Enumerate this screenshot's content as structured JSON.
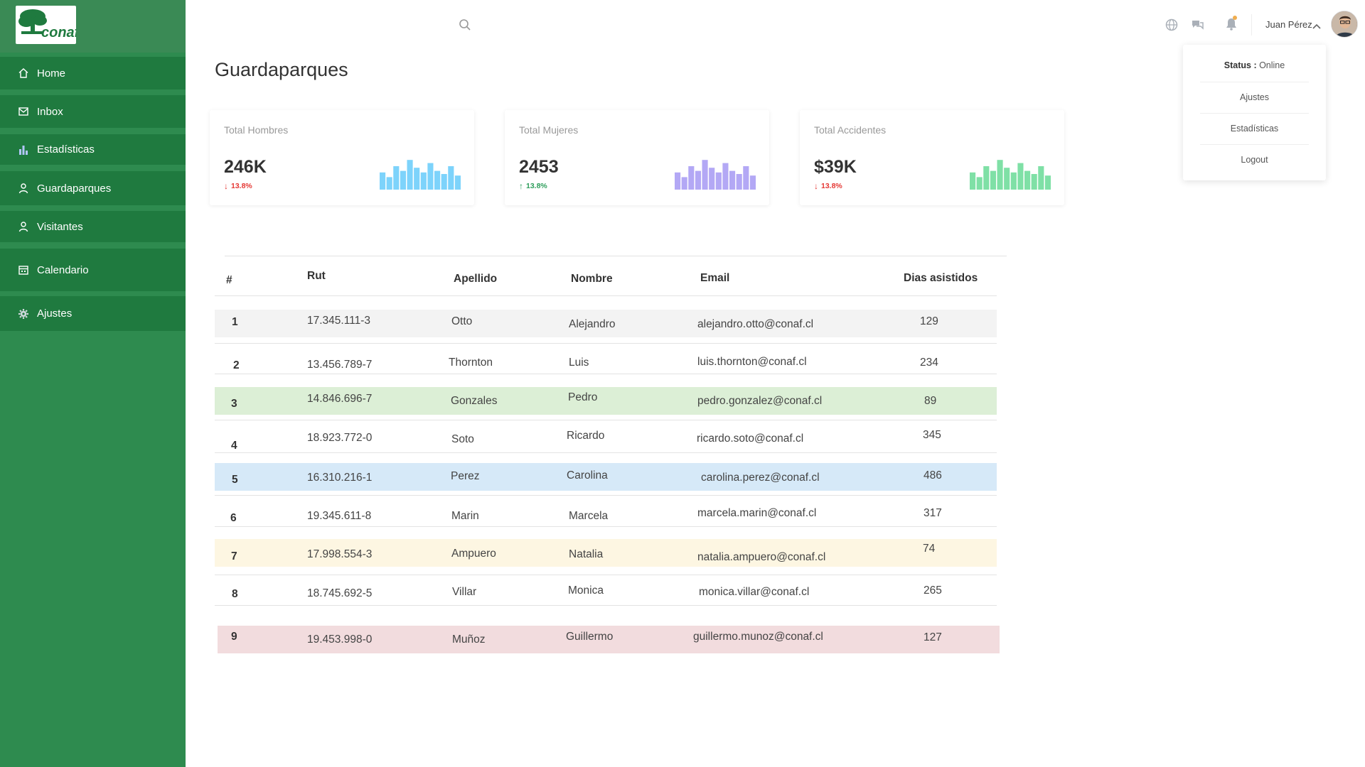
{
  "colors": {
    "sidebar": "#2e8b4f",
    "menu_item": "#1f7a3f",
    "accent_down": "#e53935",
    "accent_up": "#2e9e5b",
    "spark_blue": "#7dd3fb",
    "spark_purple": "#b3a8f5",
    "spark_green": "#7fe0a6",
    "row_gray": "#f3f3f3",
    "row_green": "#dcefd6",
    "row_blue": "#d6e9f8",
    "row_yellow": "#fdf6e2",
    "row_red": "#f2dcde"
  },
  "brand": {
    "logo_text": "conaf"
  },
  "sidebar": {
    "items": [
      {
        "label": "Home",
        "icon": "home-icon"
      },
      {
        "label": "Inbox",
        "icon": "inbox-icon"
      },
      {
        "label": "Estadísticas",
        "icon": "bar-chart-icon"
      },
      {
        "label": "Guardaparques",
        "icon": "user-icon"
      },
      {
        "label": "Visitantes",
        "icon": "user-icon"
      },
      {
        "label": "Calendario",
        "icon": "calendar-icon"
      },
      {
        "label": "Ajustes",
        "icon": "gear-icon"
      }
    ]
  },
  "topbar": {
    "user_name": "Juan Pérez"
  },
  "dropdown": {
    "status_label": "Status :",
    "status_value": " Online",
    "items": [
      "Ajustes",
      "Estadísticas",
      "Logout"
    ]
  },
  "page": {
    "title": "Guardaparques"
  },
  "cards": [
    {
      "title": "Total Hombres",
      "value": "246K",
      "change": "13.8%",
      "direction": "down",
      "color": "spark_blue"
    },
    {
      "title": "Total Mujeres",
      "value": "2453",
      "change": "13.8%",
      "direction": "up",
      "color": "spark_purple"
    },
    {
      "title": "Total Accidentes",
      "value": "$39K",
      "change": "13.8%",
      "direction": "down",
      "color": "spark_green"
    }
  ],
  "table": {
    "headers": [
      "#",
      "Rut",
      "Apellido",
      "Nombre",
      "Email",
      "Dias asistidos"
    ],
    "rows": [
      {
        "n": "1",
        "rut": "17.345.111-3",
        "apellido": "Otto",
        "nombre": "Alejandro",
        "email": "alejandro.otto@conaf.cl",
        "dias": "129",
        "bg": "row_gray"
      },
      {
        "n": "2",
        "rut": "13.456.789-7",
        "apellido": "Thornton",
        "nombre": "Luis",
        "email": "luis.thornton@conaf.cl",
        "dias": "234",
        "bg": ""
      },
      {
        "n": "3",
        "rut": "14.846.696-7",
        "apellido": "Gonzales",
        "nombre": "Pedro",
        "email": "pedro.gonzalez@conaf.cl",
        "dias": "89",
        "bg": "row_green"
      },
      {
        "n": "4",
        "rut": "18.923.772-0",
        "apellido": "Soto",
        "nombre": "Ricardo",
        "email": "ricardo.soto@conaf.cl",
        "dias": "345",
        "bg": ""
      },
      {
        "n": "5",
        "rut": "16.310.216-1",
        "apellido": "Perez",
        "nombre": "Carolina",
        "email": "carolina.perez@conaf.cl",
        "dias": "486",
        "bg": "row_blue"
      },
      {
        "n": "6",
        "rut": "19.345.611-8",
        "apellido": "Marin",
        "nombre": "Marcela",
        "email": "marcela.marin@conaf.cl",
        "dias": "317",
        "bg": ""
      },
      {
        "n": "7",
        "rut": "17.998.554-3",
        "apellido": "Ampuero",
        "nombre": "Natalia",
        "email": "natalia.ampuero@conaf.cl",
        "dias": "74",
        "bg": "row_yellow"
      },
      {
        "n": "8",
        "rut": "18.745.692-5",
        "apellido": "Villar",
        "nombre": "Monica",
        "email": "monica.villar@conaf.cl",
        "dias": "265",
        "bg": ""
      },
      {
        "n": "9",
        "rut": "19.453.998-0",
        "apellido": "Muñoz",
        "nombre": "Guillermo",
        "email": "guillermo.munoz@conaf.cl",
        "dias": "127",
        "bg": "row_red"
      }
    ]
  }
}
